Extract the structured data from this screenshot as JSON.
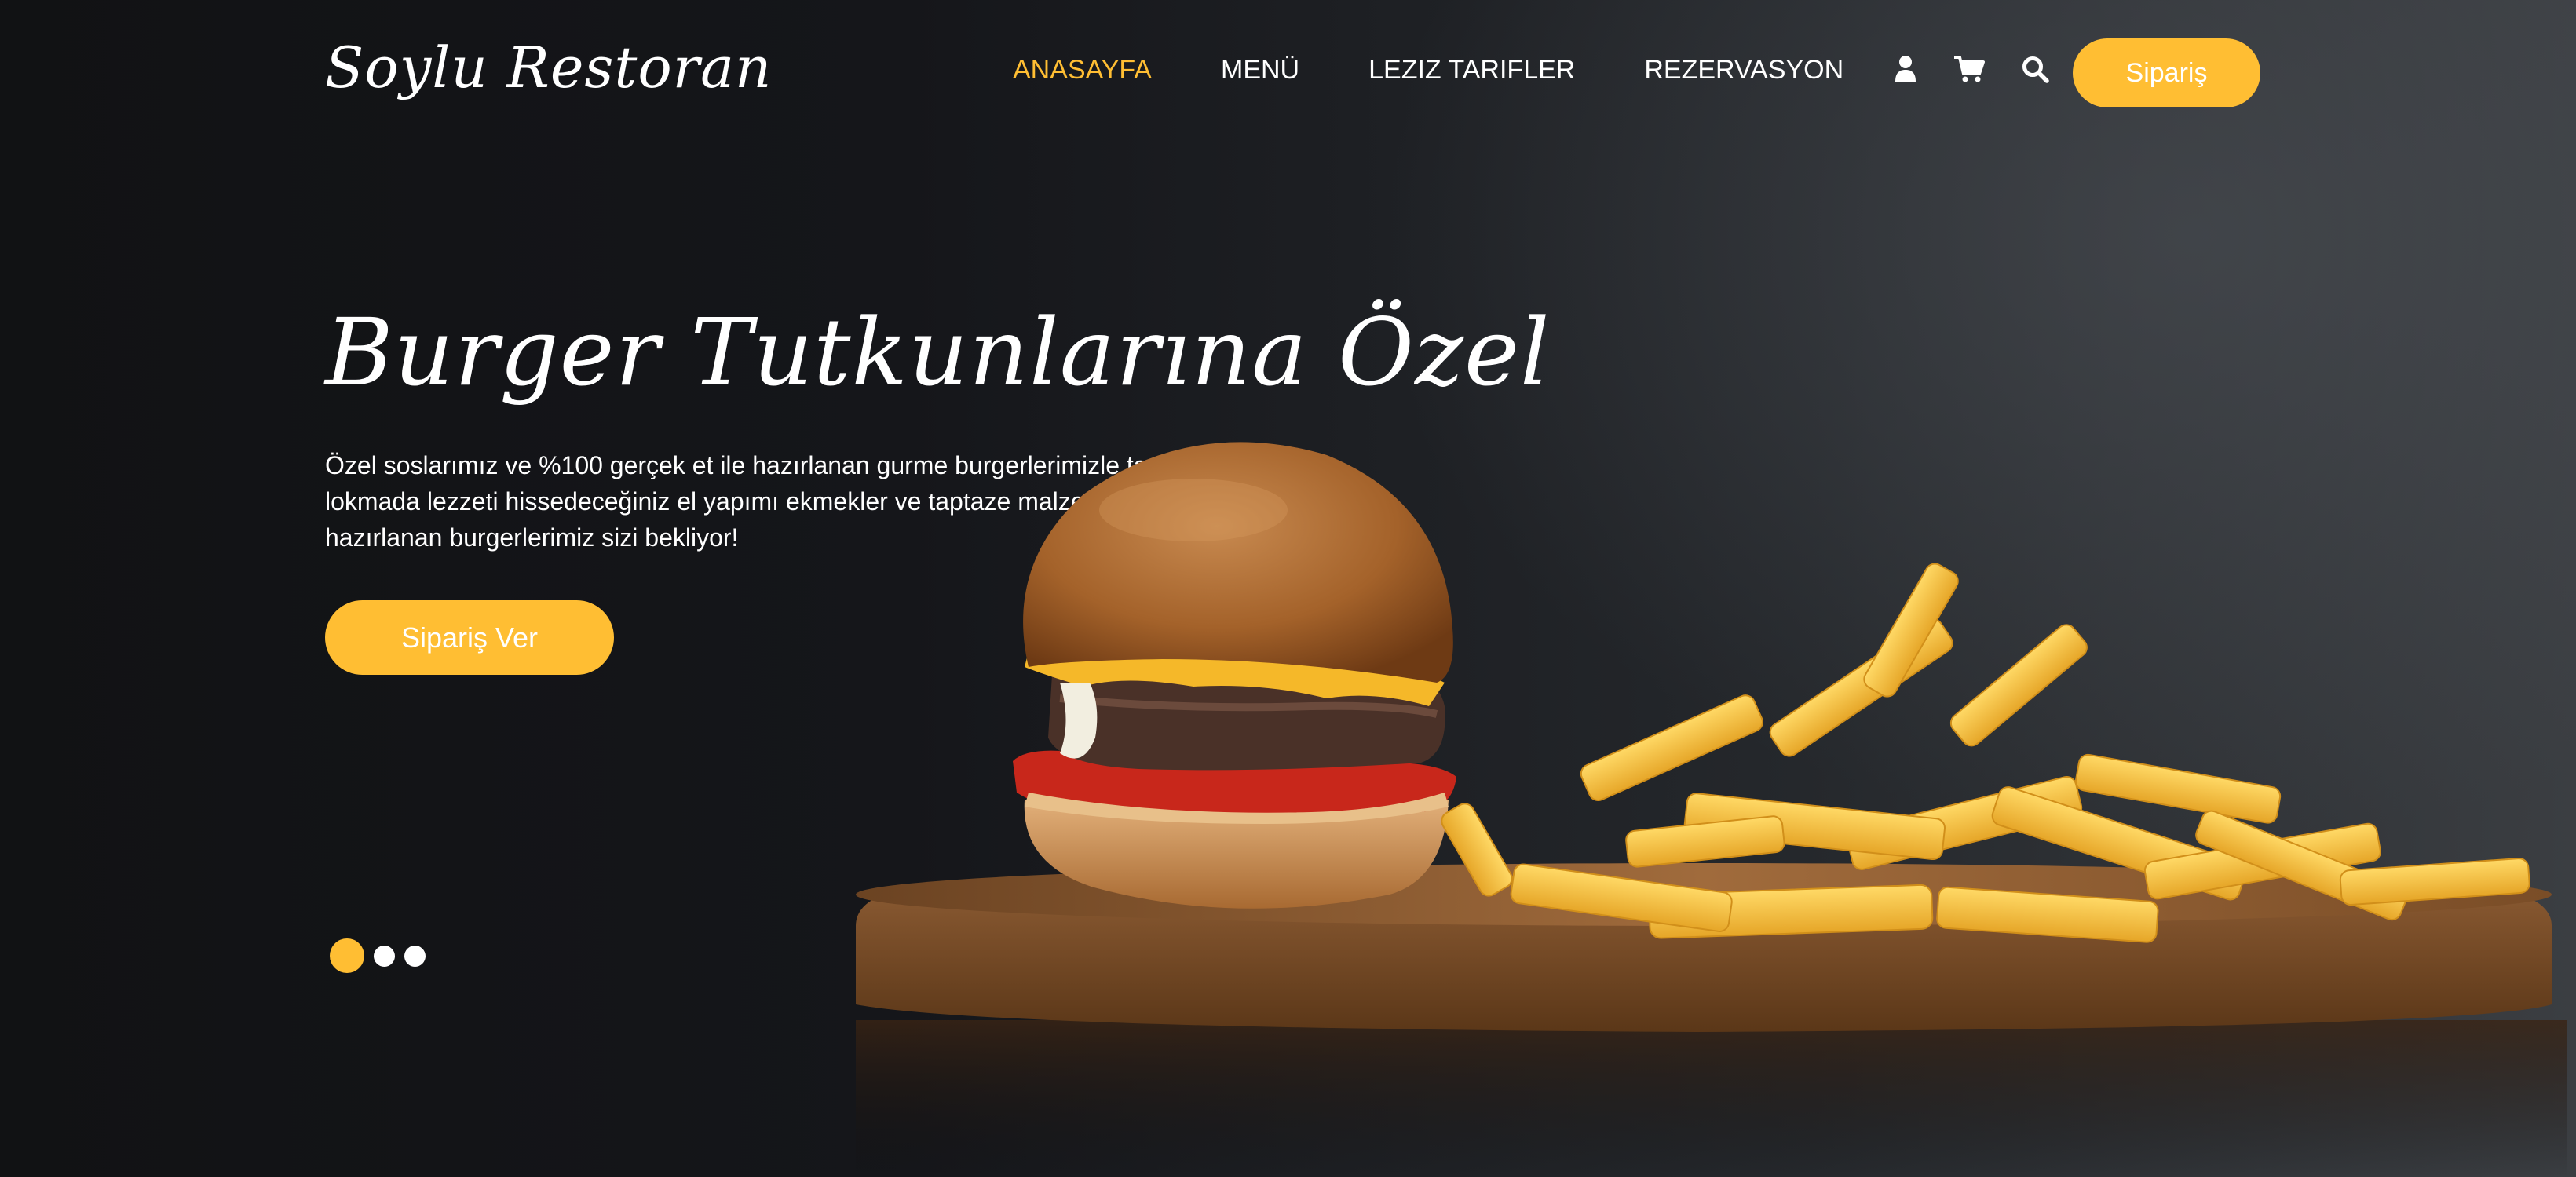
{
  "brand": {
    "logo": "Soylu Restoran"
  },
  "nav": {
    "items": [
      {
        "label": "ANASAYFA",
        "active": true
      },
      {
        "label": "MENÜ",
        "active": false
      },
      {
        "label": "LEZIZ TARIFLER",
        "active": false
      },
      {
        "label": "REZERVASYON",
        "active": false
      }
    ],
    "icons": [
      "user-icon",
      "cart-icon",
      "search-icon"
    ],
    "order_button": "Sipariş"
  },
  "hero": {
    "title": "Burger Tutkunlarına Özel",
    "description": "Özel soslarımız ve %100 gerçek et ile hazırlanan gurme burgerlerimizle tanışın. Her lokmada lezzeti hissedeceğiniz el yapımı ekmekler ve taptaze malzemelerle hazırlanan burgerlerimiz sizi bekliyor!",
    "cta": "Sipariş Ver",
    "slider": {
      "count": 3,
      "active_index": 0
    }
  },
  "colors": {
    "accent": "#ffbe33",
    "text": "#ffffff",
    "background": "#131416"
  }
}
